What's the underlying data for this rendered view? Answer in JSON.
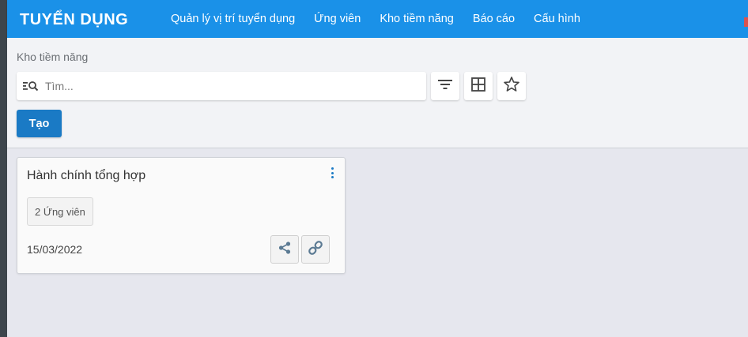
{
  "app": {
    "brand": "TUYỂN DỤNG"
  },
  "nav": {
    "items": [
      {
        "label": "Quản lý vị trí tuyển dụng"
      },
      {
        "label": "Ứng viên"
      },
      {
        "label": "Kho tiềm năng"
      },
      {
        "label": "Báo cáo"
      },
      {
        "label": "Cấu hình"
      }
    ]
  },
  "control_panel": {
    "breadcrumb": "Kho tiềm năng",
    "search": {
      "placeholder": "Tìm...",
      "value": ""
    },
    "tools": {
      "filter_icon": "filter-icon",
      "group_icon": "grid-icon",
      "favorite_icon": "star-icon"
    },
    "create_label": "Tạo"
  },
  "cards": [
    {
      "title": "Hành chính tổng hợp",
      "candidates_label": "2 Ứng viên",
      "date": "15/03/2022",
      "actions": [
        "share-icon",
        "link-icon"
      ]
    }
  ],
  "colors": {
    "navbar": "#1a91e8",
    "primary_button": "#1a7ac5",
    "background": "#e6e7ee",
    "panel": "#f2f3f6"
  }
}
